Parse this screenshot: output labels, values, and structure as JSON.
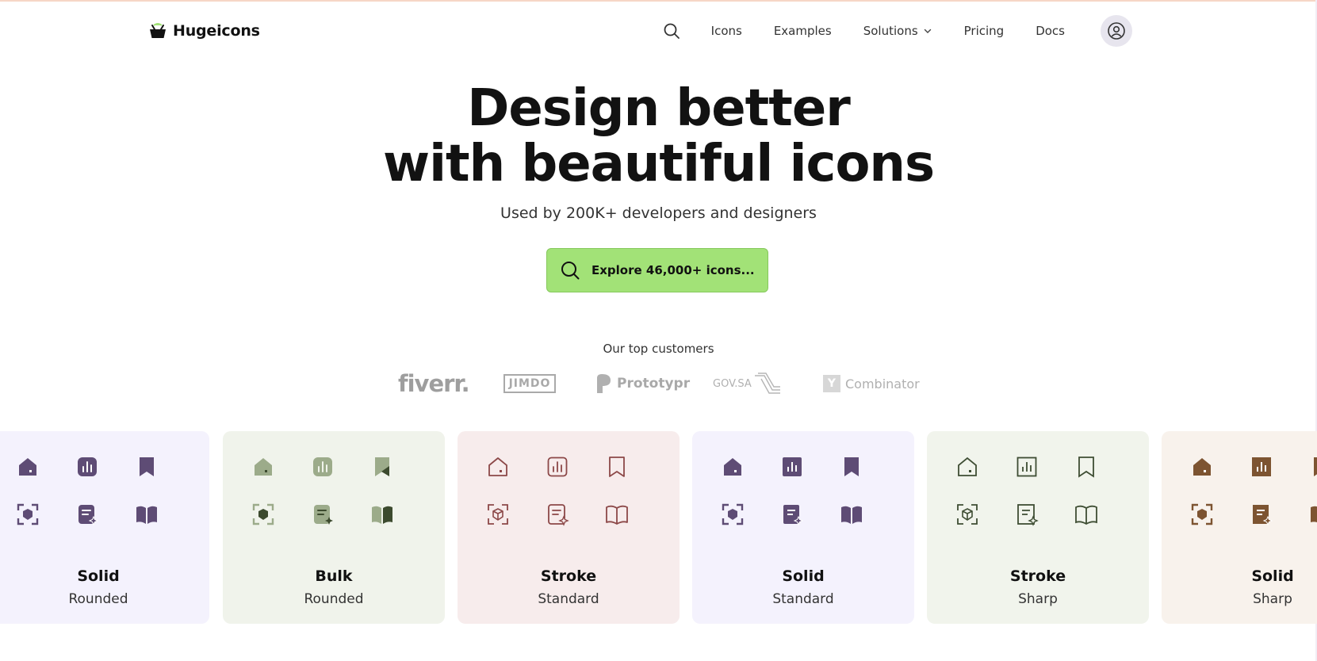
{
  "header": {
    "logo_text": "Hugeicons",
    "nav": [
      {
        "label": "Icons"
      },
      {
        "label": "Examples"
      },
      {
        "label": "Solutions"
      },
      {
        "label": "Pricing"
      },
      {
        "label": "Docs"
      }
    ]
  },
  "hero": {
    "title_line1": "Design better",
    "title_line2": "with beautiful icons",
    "subtitle": "Used by 200K+ developers and designers",
    "cta_label": "Explore 46,000+ icons..."
  },
  "customers": {
    "label": "Our top customers",
    "logos": [
      "fiverr.",
      "JIMDO",
      "Prototypr",
      "GOV.SA",
      "Combinator"
    ],
    "ycomb_mark": "Y"
  },
  "styles": [
    {
      "name": "Solid",
      "variant": "Rounded",
      "background": "#f4f2fd",
      "icon_color": "#5e4c75"
    },
    {
      "name": "Bulk",
      "variant": "Rounded",
      "background": "#f0f3eb",
      "icon_color": "#9cab8a"
    },
    {
      "name": "Stroke",
      "variant": "Standard",
      "background": "#f7ecec",
      "icon_color": "#8c4848"
    },
    {
      "name": "Solid",
      "variant": "Standard",
      "background": "#f4f2fd",
      "icon_color": "#5e4c75"
    },
    {
      "name": "Stroke",
      "variant": "Sharp",
      "background": "#f1f4ec",
      "icon_color": "#3e4d33"
    },
    {
      "name": "Solid",
      "variant": "Sharp",
      "background": "#f8f2ec",
      "icon_color": "#7d5431"
    }
  ],
  "colors": {
    "cta_green": "#a2e277",
    "top_border": "#f6d6c6"
  }
}
